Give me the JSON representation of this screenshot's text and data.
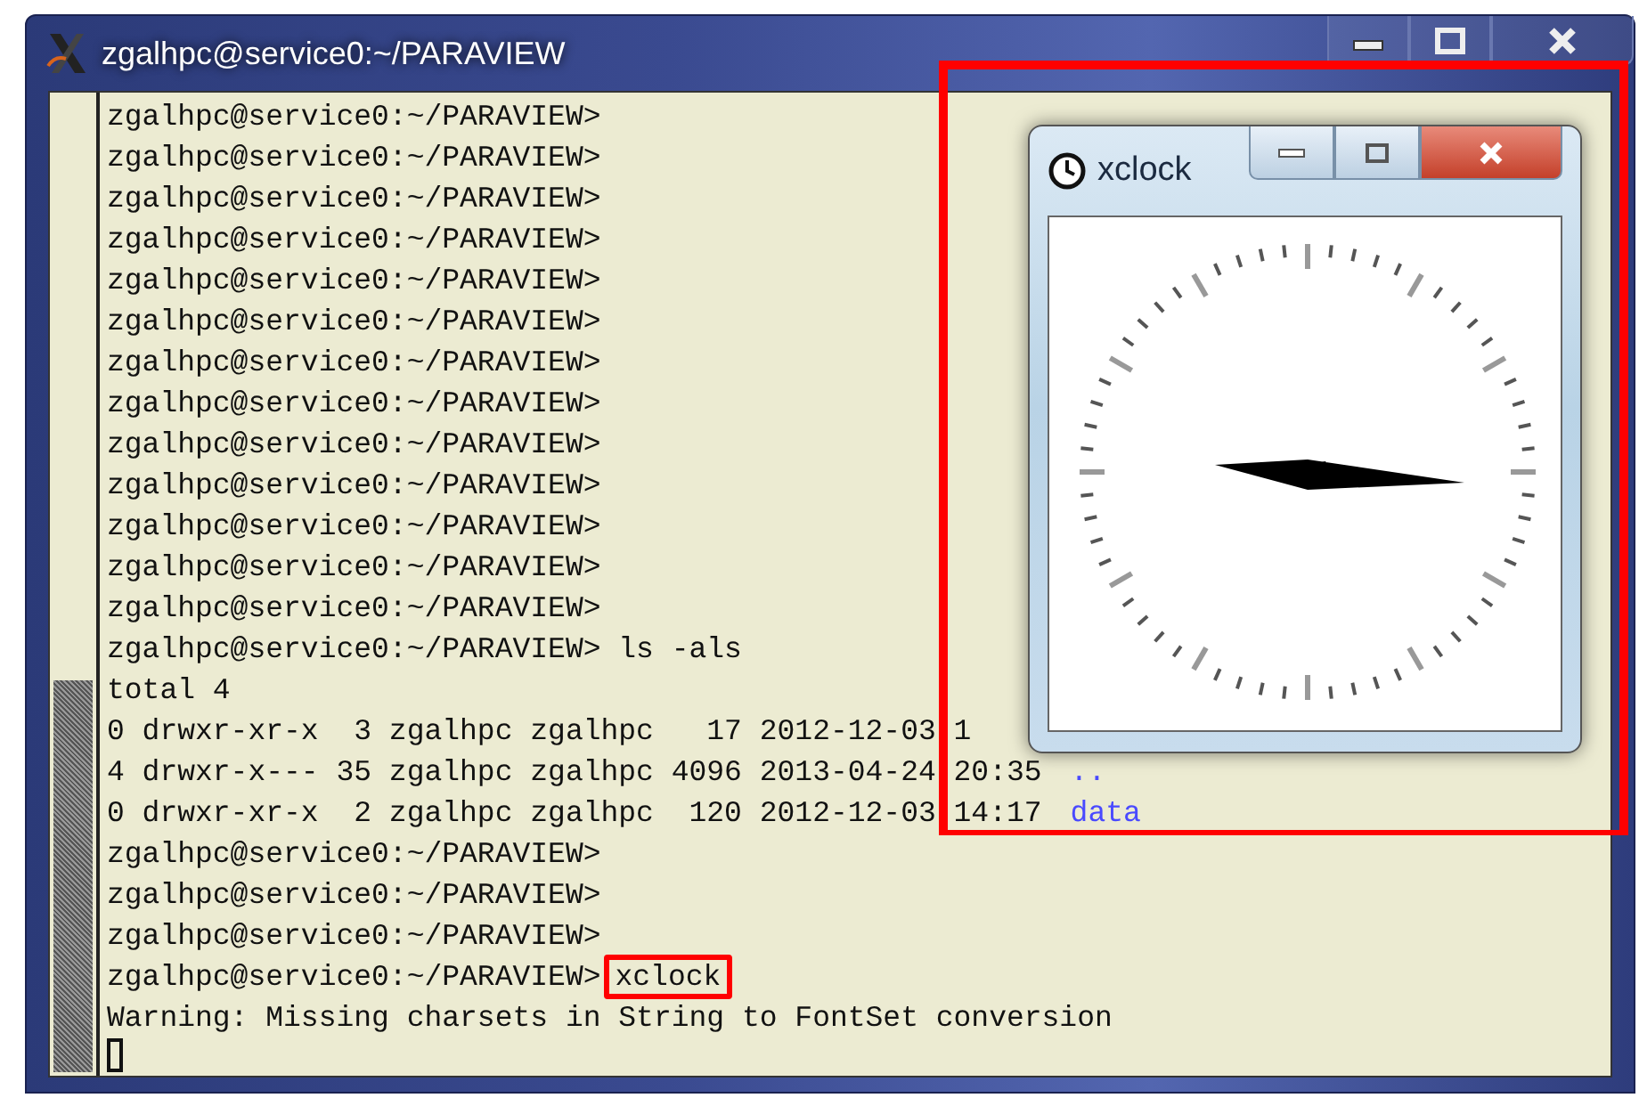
{
  "terminal_window": {
    "title": "zgalhpc@service0:~/PARAVIEW",
    "lines": [
      {
        "text": "zgalhpc@service0:~/PARAVIEW>"
      },
      {
        "text": "zgalhpc@service0:~/PARAVIEW>"
      },
      {
        "text": "zgalhpc@service0:~/PARAVIEW>"
      },
      {
        "text": "zgalhpc@service0:~/PARAVIEW>"
      },
      {
        "text": "zgalhpc@service0:~/PARAVIEW>"
      },
      {
        "text": "zgalhpc@service0:~/PARAVIEW>"
      },
      {
        "text": "zgalhpc@service0:~/PARAVIEW>"
      },
      {
        "text": "zgalhpc@service0:~/PARAVIEW>"
      },
      {
        "text": "zgalhpc@service0:~/PARAVIEW>"
      },
      {
        "text": "zgalhpc@service0:~/PARAVIEW>"
      },
      {
        "text": "zgalhpc@service0:~/PARAVIEW>"
      },
      {
        "text": "zgalhpc@service0:~/PARAVIEW>"
      },
      {
        "text": "zgalhpc@service0:~/PARAVIEW>"
      },
      {
        "text": "zgalhpc@service0:~/PARAVIEW>",
        "command": "ls -als",
        "highlighted": false
      },
      {
        "text": "total 4"
      },
      {
        "text": "0 drwxr-xr-x  3 zgalhpc zgalhpc   17 2012-12-03 1"
      },
      {
        "text": "4 drwxr-x--- 35 zgalhpc zgalhpc 4096 2013-04-24 20:35",
        "entry": ".."
      },
      {
        "text": "0 drwxr-xr-x  2 zgalhpc zgalhpc  120 2012-12-03 14:17",
        "entry": "data"
      },
      {
        "text": "zgalhpc@service0:~/PARAVIEW>"
      },
      {
        "text": "zgalhpc@service0:~/PARAVIEW>"
      },
      {
        "text": "zgalhpc@service0:~/PARAVIEW>"
      },
      {
        "text": "zgalhpc@service0:~/PARAVIEW>",
        "command": "xclock",
        "highlighted": true
      },
      {
        "text": "Warning: Missing charsets in String to FontSet conversion"
      }
    ]
  },
  "xclock_window": {
    "title": "xclock"
  }
}
